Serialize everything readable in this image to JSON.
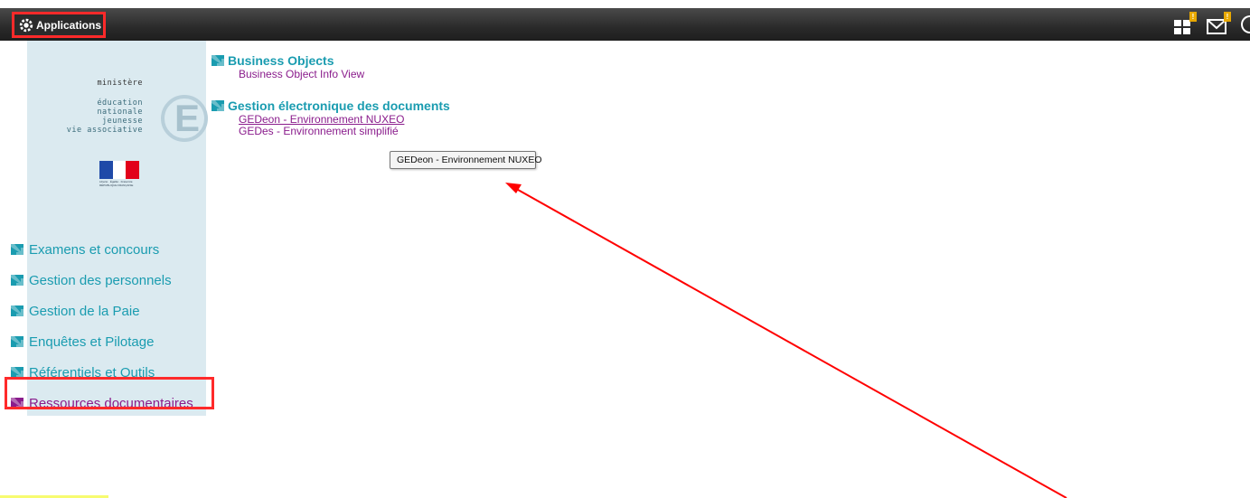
{
  "header": {
    "apps_label": "Applications",
    "icons": [
      "apps-grid-icon",
      "mail-icon",
      "user-icon"
    ],
    "badges": [
      "!",
      "!"
    ]
  },
  "sidebar": {
    "logo": {
      "line1": "ministère",
      "line2": "éducation",
      "line3": "nationale",
      "line4": "jeunesse",
      "line5": "vie associative",
      "letter": "E",
      "motto": "Liberté · Égalité · Fraternité RÉPUBLIQUE FRANÇAISE"
    },
    "items": [
      {
        "label": "Examens et concours"
      },
      {
        "label": "Gestion des personnels"
      },
      {
        "label": "Gestion de la Paie"
      },
      {
        "label": "Enquêtes et Pilotage"
      },
      {
        "label": "Référentiels et Outils"
      },
      {
        "label": "Ressources documentaires"
      }
    ]
  },
  "main": {
    "sections": [
      {
        "title": "Business Objects",
        "links": [
          "Business Object Info View"
        ]
      },
      {
        "title": "Gestion électronique des documents",
        "links": [
          "GEDeon - Environnement NUXEO",
          "GEDes - Environnement simplifié"
        ]
      }
    ],
    "tooltip": "GEDeon  - Environnement NUXEO"
  },
  "colors": {
    "accent": "#1a9cb0",
    "link": "#8a1c8c",
    "highlight": "#ff2a2a",
    "topbar": "#2b2b2b",
    "sidebar_bg": "#dbeaf0"
  }
}
